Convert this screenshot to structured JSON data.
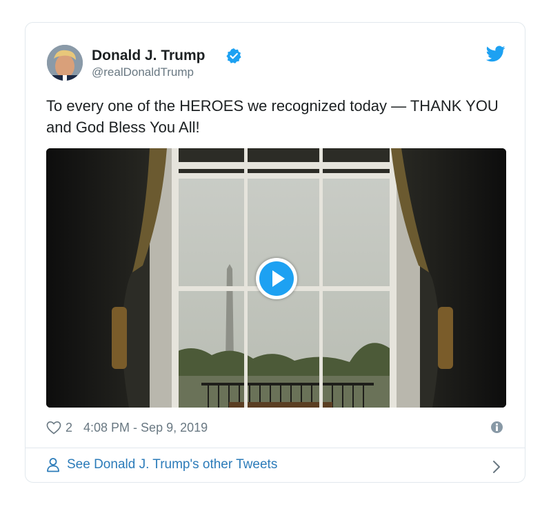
{
  "tweet": {
    "author_name": "Donald J. Trump",
    "handle": "@realDonaldTrump",
    "text": "To every one of the HEROES we recognized today — THANK YOU and God Bless You All!",
    "like_count": "2",
    "timestamp": "4:08 PM - Sep 9, 2019",
    "verified": true
  },
  "footer": {
    "link_label": "See Donald J. Trump's other Tweets"
  },
  "icons": {
    "verified": "verified-badge-icon",
    "logo": "twitter-bird-icon",
    "heart": "heart-icon",
    "info": "info-icon",
    "person": "person-icon",
    "chevron": "chevron-right-icon",
    "play": "play-icon"
  },
  "colors": {
    "accent": "#1da1f2",
    "link": "#2b7bb9",
    "muted": "#697882",
    "border": "#e1e8ed"
  }
}
